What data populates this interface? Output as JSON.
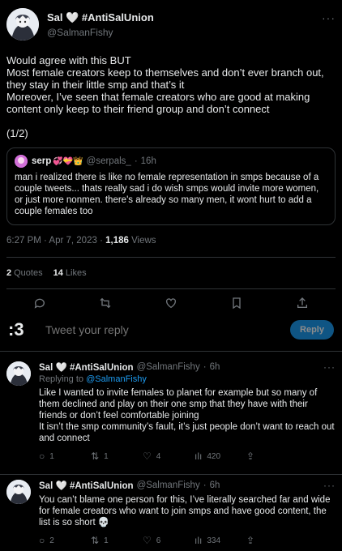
{
  "main_tweet": {
    "author_name": "Sal 🤍 #AntiSalUnion",
    "author_handle": "@SalmanFishy",
    "body": "Would agree with this BUT\nMost female creators keep to themselves and don’t ever branch out, they stay in their little smp and that’s it\nMoreover, I’ve seen that female creators who are good at making content only keep to their friend group and don’t connect\n\n(1/2)",
    "quote": {
      "name": "serp",
      "emojis": "💞💝👑",
      "handle": "@serpals_",
      "time": "16h",
      "text": "man i realized there is like no female representation in smps because of a couple tweets... thats really sad i do wish smps would invite more women, or just more nonmen. there's already so many men, it wont hurt to add a couple females too"
    },
    "timestamp": "6:27 PM · Apr 7, 2023 ·",
    "views_count": "1,186",
    "views_label": "Views",
    "quotes_count": "2",
    "quotes_label": "Quotes",
    "likes_count": "14",
    "likes_label": "Likes"
  },
  "compose": {
    "avatar_text": ":3",
    "placeholder": "Tweet your reply",
    "reply_button": "Reply"
  },
  "replies": [
    {
      "author_name": "Sal 🤍 #AntiSalUnion",
      "handle": "@SalmanFishy",
      "time": "6h",
      "replying_prefix": "Replying to",
      "replying_handle": "@SalmanFishy",
      "text": "Like I wanted to invite females to planet for example but so many of them declined and play on their one smp that they have with their friends or don’t feel comfortable joining\nIt isn’t the smp community’s fault, it’s just people don’t want to reach out and connect",
      "replies": "1",
      "retweets": "1",
      "likes": "4",
      "views": "420"
    },
    {
      "author_name": "Sal 🤍 #AntiSalUnion",
      "handle": "@SalmanFishy",
      "time": "6h",
      "text": "You can’t blame one person for this, I’ve literally searched far and wide for female creators who want to join smps and have good content, the list is so short 💀",
      "replies": "2",
      "retweets": "1",
      "likes": "6",
      "views": "334"
    }
  ],
  "colors": {
    "background": "#000000",
    "text": "#e7e9ea",
    "muted": "#71767b",
    "accent": "#1d9bf0",
    "border": "#2f3336"
  },
  "icons": [
    "more-icon",
    "reply-icon",
    "retweet-icon",
    "like-icon",
    "bookmark-icon",
    "share-icon",
    "views-icon"
  ]
}
